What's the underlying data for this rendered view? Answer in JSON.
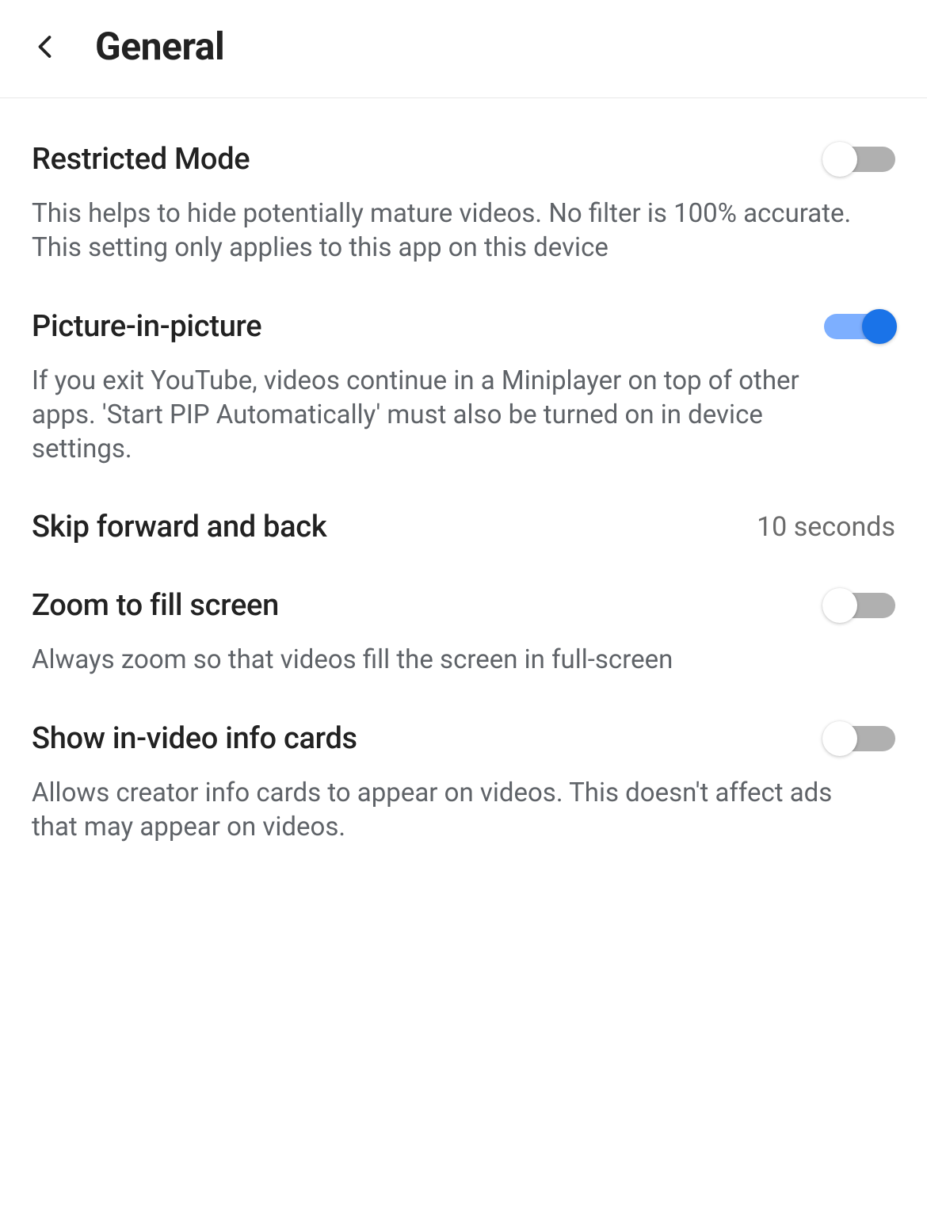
{
  "header": {
    "title": "General"
  },
  "settings": {
    "restricted_mode": {
      "title": "Restricted Mode",
      "description": "This helps to hide potentially mature videos. No filter is 100% accurate. This setting only applies to this app on this device",
      "enabled": false
    },
    "picture_in_picture": {
      "title": "Picture-in-picture",
      "description": "If you exit YouTube, videos continue in a Miniplayer on top of other apps. 'Start PIP Automatically' must also be turned on in device settings.",
      "enabled": true
    },
    "skip_forward_back": {
      "title": "Skip forward and back",
      "value": "10 seconds"
    },
    "zoom_to_fill": {
      "title": "Zoom to fill screen",
      "description": "Always zoom so that videos fill the screen in full-screen",
      "enabled": false
    },
    "info_cards": {
      "title": "Show in-video info cards",
      "description": "Allows creator info cards to appear on videos. This doesn't affect ads that may appear on videos.",
      "enabled": false
    }
  }
}
